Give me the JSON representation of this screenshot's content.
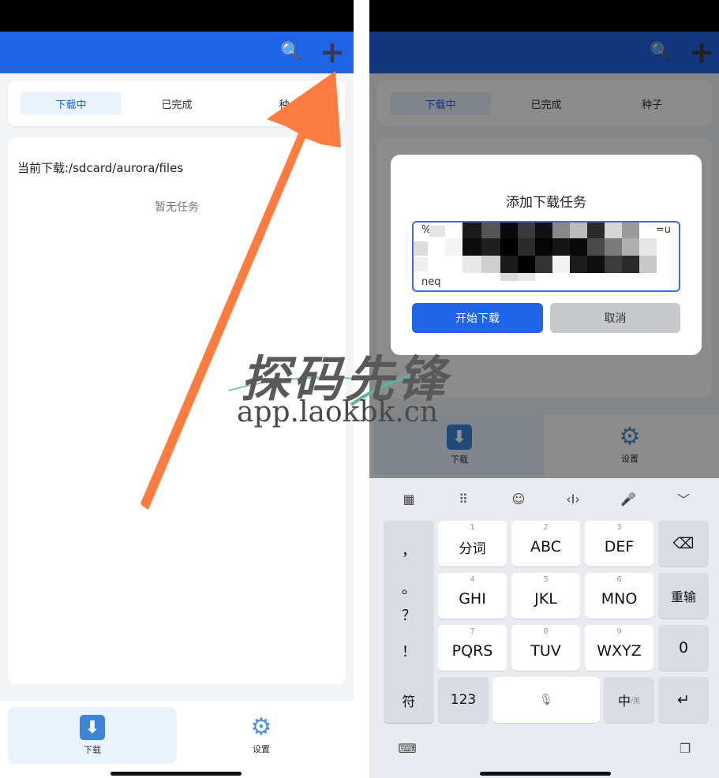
{
  "left": {
    "tabs": [
      {
        "label": "下载中",
        "active": true
      },
      {
        "label": "已完成",
        "active": false
      },
      {
        "label": "种",
        "active": false
      }
    ],
    "current_path": "当前下载:/sdcard/aurora/files",
    "empty_text": "暂无任务",
    "nav": [
      {
        "label": "下载",
        "icon": "download-icon",
        "active": true
      },
      {
        "label": "设置",
        "icon": "gear-icon",
        "active": false
      }
    ]
  },
  "right": {
    "tabs": [
      {
        "label": "下载中",
        "active": true
      },
      {
        "label": "已完成",
        "active": false
      },
      {
        "label": "种子",
        "active": false
      }
    ],
    "dialog": {
      "title": "添加下载任务",
      "url_start": "%",
      "url_end": "=u",
      "url_tail": "neq",
      "start_button": "开始下载",
      "cancel_button": "取消"
    },
    "nav": [
      {
        "label": "下载",
        "icon": "download-icon"
      },
      {
        "label": "设置",
        "icon": "gear-icon"
      }
    ],
    "keyboard": {
      "toolbar_icons": [
        "grid-icon",
        "keyboard-layout-icon",
        "emoji-icon",
        "cursor-icon",
        "mic-icon",
        "collapse-icon"
      ],
      "symbols": [
        "，",
        "。",
        "？",
        "！"
      ],
      "rows": [
        [
          {
            "num": "1",
            "label": "分词"
          },
          {
            "num": "2",
            "label": "ABC"
          },
          {
            "num": "3",
            "label": "DEF"
          }
        ],
        [
          {
            "num": "4",
            "label": "GHI"
          },
          {
            "num": "5",
            "label": "JKL"
          },
          {
            "num": "6",
            "label": "MNO"
          }
        ],
        [
          {
            "num": "7",
            "label": "PQRS"
          },
          {
            "num": "8",
            "label": "TUV"
          },
          {
            "num": "9",
            "label": "WXYZ"
          }
        ]
      ],
      "side_keys": {
        "delete": "⌫",
        "retype": "重输",
        "zero": "0",
        "enter": "↵"
      },
      "bottom": {
        "symbol": "符",
        "numbers": "123",
        "lang_main": "中",
        "lang_sub": "/英"
      }
    }
  },
  "watermark": {
    "line1": "探码先锋",
    "line2": "app.laokbk.cn"
  },
  "colors": {
    "primary": "#1f63e6",
    "arrow": "#ff7c40",
    "active_tab_bg": "#eaf2fe"
  }
}
